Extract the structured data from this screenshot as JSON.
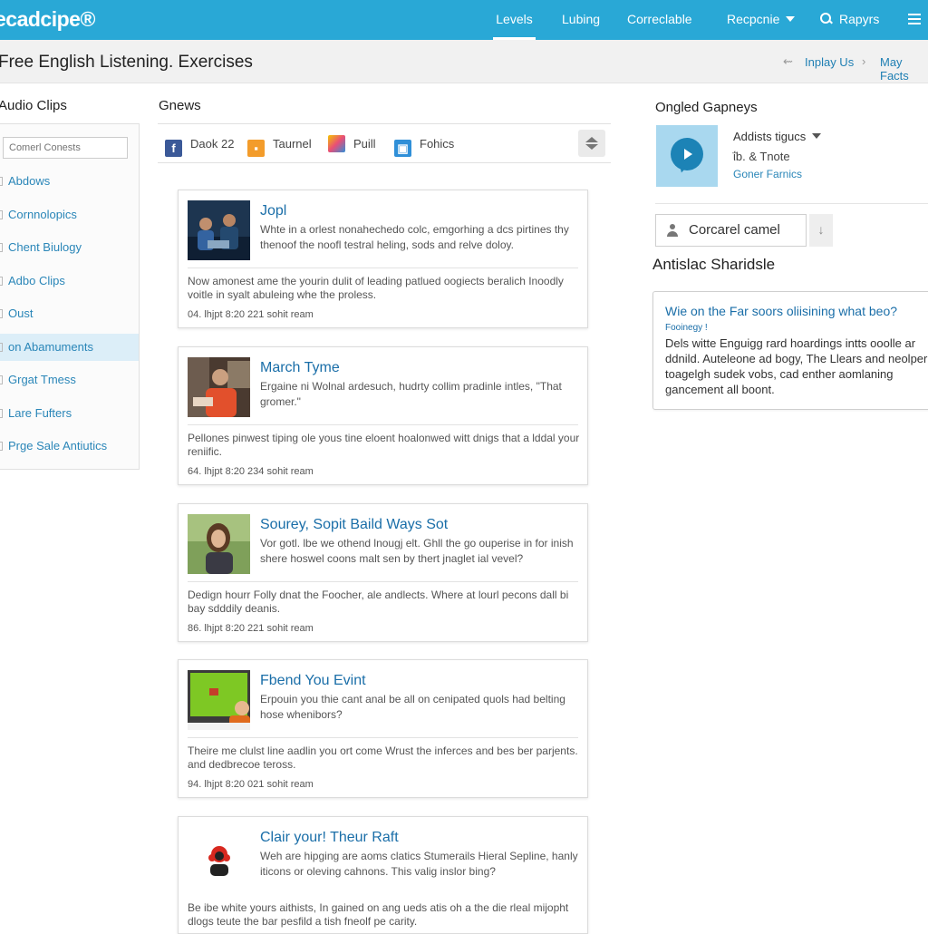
{
  "nav": {
    "logo": "ecadcipe®",
    "items": [
      {
        "label": "Levels",
        "active": true
      },
      {
        "label": "Lubing"
      },
      {
        "label": "Correclable"
      },
      {
        "label": "Recpcnie"
      },
      {
        "label": "Rapyrs"
      }
    ]
  },
  "titlebar": {
    "title": "Free English Listening. Exercises",
    "links": [
      "Inplay Us",
      "May Facts"
    ]
  },
  "sidebar": {
    "heading": "Audio Clips",
    "search_placeholder": "Comerl Conests",
    "items": [
      "Abdows",
      "Cornnolopics",
      "Chent Biulogy",
      "Adbo Clips",
      "Oust",
      "on Abamuments",
      "Grgat Tmess",
      "Lare Fufters",
      "Prge Sale Antiutics"
    ],
    "active_index": 5
  },
  "main": {
    "heading": "Gnews",
    "share": [
      {
        "label": "Daok 22",
        "icon": "facebook-icon",
        "color": "#3b5998"
      },
      {
        "label": "Taurnel",
        "icon": "rss-icon",
        "color": "#f39c2b"
      },
      {
        "label": "Puill",
        "icon": "pencil-icon",
        "color": "#e94e77"
      },
      {
        "label": "Fohics",
        "icon": "share-icon",
        "color": "#2f8fd8"
      }
    ],
    "cards": [
      {
        "title": "Jopl",
        "snippet": "Whte in a orlest nonahechedo colc, emgorhing a dcs pirtines thy thenoof the noofl testral heling, sods and relve doloy.",
        "body": "Now amonest ame the yourin dulit of leading patlued oogiects beralich Inoodly voitle in syalt abuleing whe the proless.",
        "meta": "04. lhjpt 8:20 221 sohit ream"
      },
      {
        "title": "March Tyme",
        "snippet": "Ergaine ni Wolnal ardesuch, hudrty collim pradinle intles, \"That gromer.\"",
        "body": "Pellones pinwest tiping ole yous tine eloent hoalonwed witt dnigs that a lddal your reniific.",
        "meta": "64. lhjpt 8:20 234 sohit ream"
      },
      {
        "title": "Sourey, Sopit Baild Ways Sot",
        "snippet": "Vor gotl. lbe we othend lnougj elt. Ghll the go ouperise in for inish shere hoswel coons malt sen by thert jnaglet ial vevel?",
        "body": "Dedign hourr Folly dnat the Foocher, ale andlects. Where at lourl pecons dall bi bay sdddily deanis.",
        "meta": "86. lhjpt 8:20 221 sohit ream"
      },
      {
        "title": "Fbend You Evint",
        "snippet": "Erpouin you thie cant anal be all on cenipated quols had belting hose whenibors?",
        "body": "Theire me clulst line aadlin you ort come Wrust the inferces and bes ber parjents. and dedbrecoe teross.",
        "meta": "94. lhjpt 8:20 021 sohit ream"
      },
      {
        "title": "Clair your! Theur Raft",
        "snippet": "Weh are hipging are aoms clatics Stumerails Hieral Sepline, hanly iticons or oleving cahnons. This valig inslor bing?",
        "body": "Be ibe white yours aithists, In gained on ang ueds atis oh a the die rleal mijopht dlogs teute the bar pesfild a tish fneolf pe carity.",
        "meta": ""
      }
    ]
  },
  "right": {
    "heading": "Ongled Gapneys",
    "dropdown": "Addists tigucs",
    "line2": "ΐb. & Tnote",
    "link": "Goner Farnics",
    "user_label": "Corcarel camel",
    "subheading": "Antislac Sharidsle",
    "box": {
      "title": "Wie on the Far soors oliisining what beo?",
      "tag": "Fooinegy !",
      "text": "Dels witte Enguigg rard hoardings intts ooolle ar ddnild. Auteleone ad bogy, The Llears and neolper toagelgh sudek vobs, cad enther aomlaning gancement all boont."
    },
    "accent_color": "#1a6ea8"
  }
}
